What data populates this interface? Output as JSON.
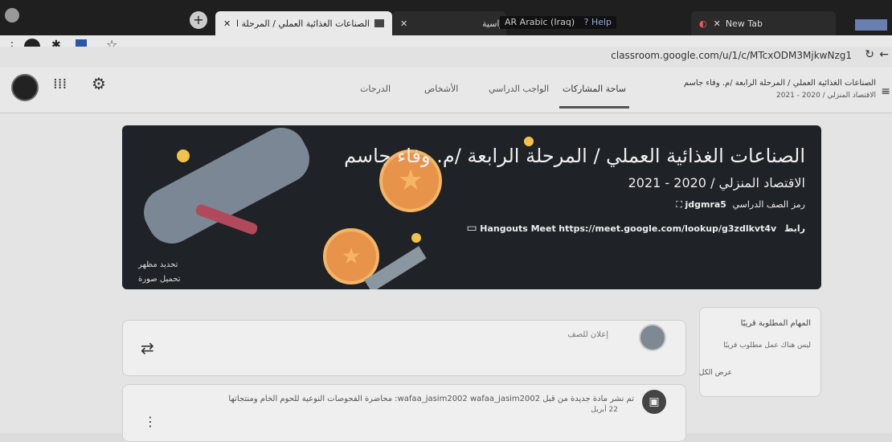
{
  "browser": {
    "tabs": [
      {
        "label": "الصناعات الغذائية العملي / المرحلة الرابعة"
      },
      {
        "label": ""
      },
      {
        "label": "دراسية"
      },
      {
        "label": "New Tab"
      }
    ],
    "lang_label": "AR Arabic (Iraq)",
    "help_label": "? Help",
    "url": "classroom.google.com/u/1/c/MTcxODM3MjkwNzg1"
  },
  "classroom": {
    "class_title": "الصناعات الغذائية العملي / المرحلة الرابعة /م. وفاء جاسم",
    "class_subtitle": "الاقتصاد المنزلي / 2020 - 2021",
    "nav_tabs": [
      "ساحة المشاركات",
      "الواجب الدراسي",
      "الأشخاص",
      "الدرجات"
    ],
    "banner": {
      "title": "الصناعات الغذائية العملي / المرحلة الرابعة /م. وفاء جاسم",
      "subtitle": "الاقتصاد المنزلي / 2020 - 2021",
      "class_code_label": "رمز الصف الدراسي",
      "class_code": "jdgmra5",
      "meet_label": "رابط Hangouts Meet",
      "meet_url": "https://meet.google.com/lookup/g3zdlkvt4v",
      "update_theme": "تحديد مظهر",
      "upload_photo": "تحميل صورة"
    },
    "upcoming": {
      "title": "المهام المطلوبة قريبًا",
      "empty": "ليس هناك عمل مطلوب قريبًا",
      "view_all": "عرض الكل"
    },
    "announce_placeholder": "إعلان للصف",
    "post": {
      "header": "تم نشر مادة جديدة من قبل wafaa_jasim2002 wafaa_jasim2002: محاضرة الفحوصات النوعية للحوم الخام ومنتجاتها",
      "date": "22 أبريل"
    }
  }
}
